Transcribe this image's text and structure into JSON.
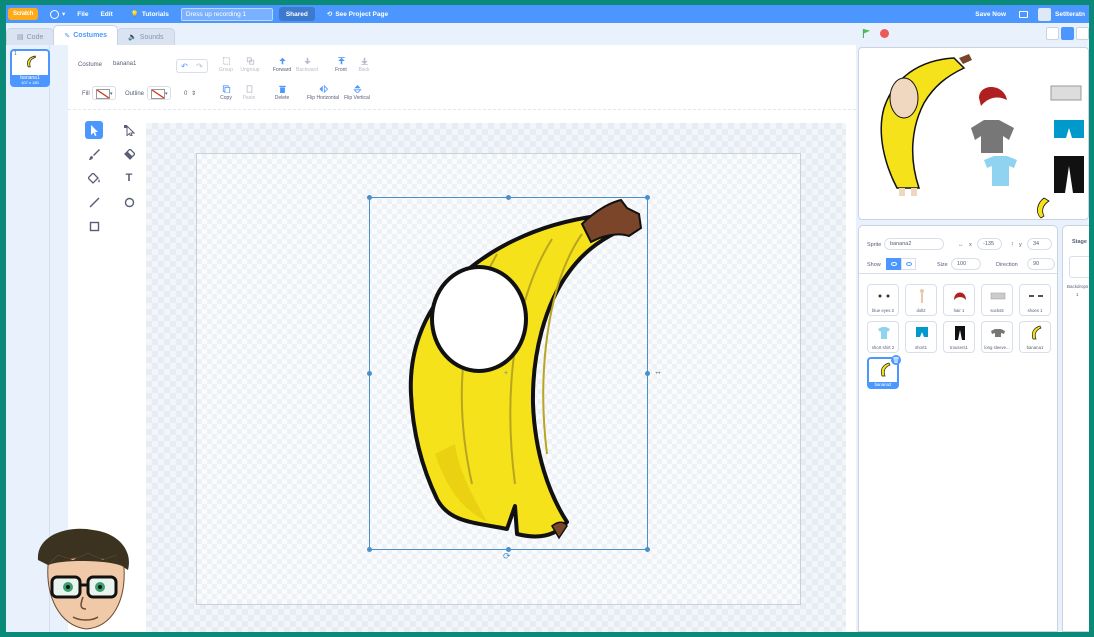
{
  "menubar": {
    "logo": "Scratch",
    "file": "File",
    "edit": "Edit",
    "tutorials": "Tutorials",
    "project_title": "Dress up recording 1",
    "shared": "Shared",
    "see_project_page": "See Project Page",
    "save_now": "Save Now",
    "username": "SetIteratn"
  },
  "tabs": {
    "code": "Code",
    "costumes": "Costumes",
    "sounds": "Sounds"
  },
  "costume_list": {
    "number": "1",
    "name": "banana1",
    "size": "107 x 180"
  },
  "toolbar": {
    "costume_label": "Costume",
    "costume_name": "banana1",
    "group": "Group",
    "ungroup": "Ungroup",
    "forward": "Forward",
    "backward": "Backward",
    "front": "Front",
    "back": "Back",
    "fill_label": "Fill",
    "outline_label": "Outline",
    "outline_width": "0",
    "copy": "Copy",
    "paste": "Paste",
    "delete": "Delete",
    "flip_horizontal": "Flip Horizontal",
    "flip_vertical": "Flip Vertical"
  },
  "sprite_info": {
    "sprite_label": "Sprite",
    "sprite_name": "banana2",
    "x_label": "x",
    "x_value": "-135",
    "y_label": "y",
    "y_value": "34",
    "show_label": "Show",
    "size_label": "Size",
    "size_value": "100",
    "direction_label": "Direction",
    "direction_value": "90"
  },
  "sprites": [
    {
      "name": "blue eyes 2"
    },
    {
      "name": "doll2"
    },
    {
      "name": "hair 1"
    },
    {
      "name": "socks5"
    },
    {
      "name": "shoes 1"
    },
    {
      "name": "short shirt 2"
    },
    {
      "name": "short1"
    },
    {
      "name": "trousers1"
    },
    {
      "name": "long sleeve..."
    },
    {
      "name": "banana1"
    },
    {
      "name": "banana2"
    }
  ],
  "stage_pane": {
    "title": "Stage",
    "backdrops_label": "Backdrops",
    "backdrops_count": "1"
  },
  "colors": {
    "accent": "#4c97ff",
    "banana": "#f5e21a",
    "stem": "#7a4528",
    "selection": "#4a90c8"
  },
  "icons": [
    "globe-icon",
    "tutorials-icon",
    "see-project-icon",
    "folder-icon",
    "green-flag-icon",
    "stop-icon",
    "select-tool-icon",
    "reshape-tool-icon",
    "brush-tool-icon",
    "eraser-tool-icon",
    "fill-tool-icon",
    "text-tool-icon",
    "line-tool-icon",
    "circle-tool-icon",
    "rectangle-tool-icon"
  ]
}
